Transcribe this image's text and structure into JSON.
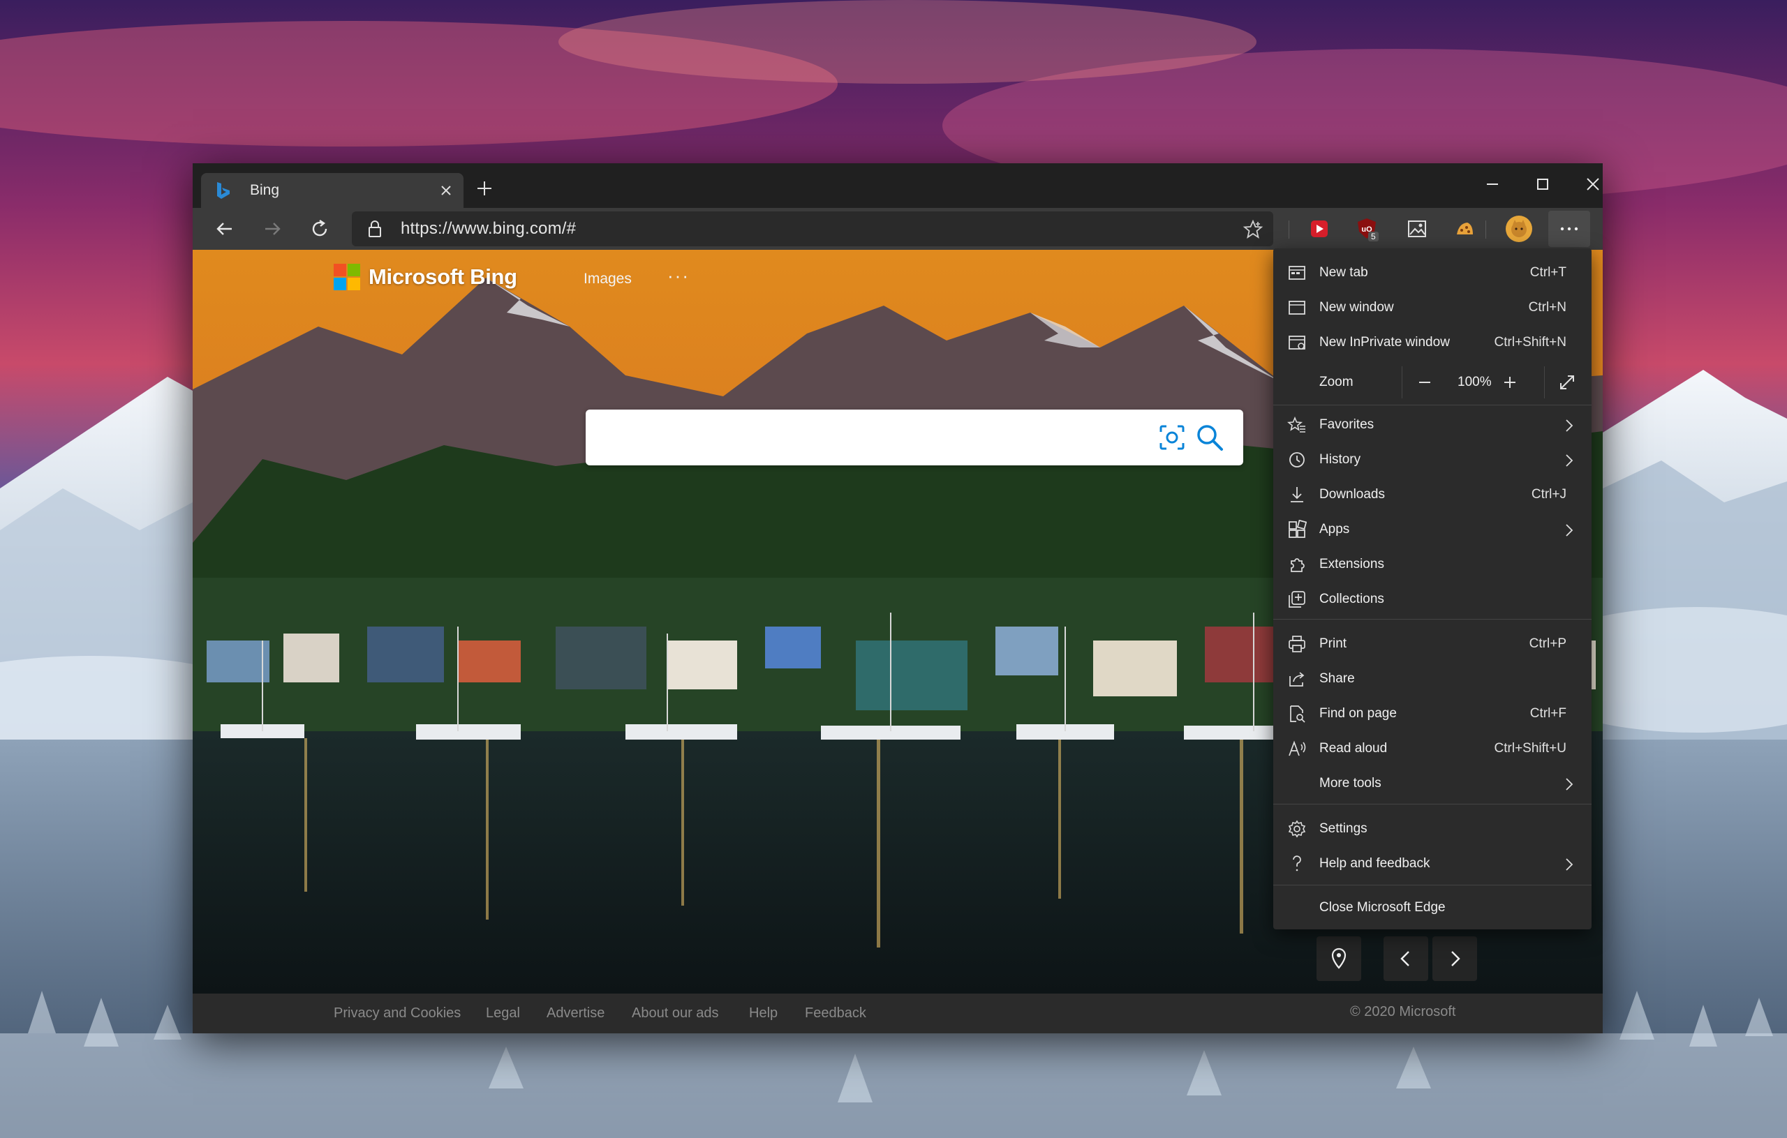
{
  "tab": {
    "title": "Bing"
  },
  "address": {
    "url": "https://www.bing.com/#"
  },
  "extensions": {
    "badge_count": "5"
  },
  "page": {
    "logo_text": "Microsoft Bing",
    "images_link": "Images",
    "more_dots": "···",
    "footer_links": [
      "Privacy and Cookies",
      "Legal",
      "Advertise",
      "About our ads",
      "Help",
      "Feedback"
    ],
    "copyright": "© 2020 Microsoft"
  },
  "menu": {
    "items": [
      {
        "label": "New tab",
        "shortcut": "Ctrl+T",
        "icon": "new-tab-icon"
      },
      {
        "label": "New window",
        "shortcut": "Ctrl+N",
        "icon": "new-window-icon"
      },
      {
        "label": "New InPrivate window",
        "shortcut": "Ctrl+Shift+N",
        "icon": "inprivate-window-icon"
      },
      {
        "label": "Favorites",
        "shortcut": "",
        "icon": "favorites-icon"
      },
      {
        "label": "History",
        "shortcut": "",
        "icon": "history-icon"
      },
      {
        "label": "Downloads",
        "shortcut": "Ctrl+J",
        "icon": "downloads-icon"
      },
      {
        "label": "Apps",
        "shortcut": "",
        "icon": "apps-icon"
      },
      {
        "label": "Extensions",
        "shortcut": "",
        "icon": "extensions-icon"
      },
      {
        "label": "Collections",
        "shortcut": "",
        "icon": "collections-icon"
      },
      {
        "label": "Print",
        "shortcut": "Ctrl+P",
        "icon": "print-icon"
      },
      {
        "label": "Share",
        "shortcut": "",
        "icon": "share-icon"
      },
      {
        "label": "Find on page",
        "shortcut": "Ctrl+F",
        "icon": "find-on-page-icon"
      },
      {
        "label": "Read aloud",
        "shortcut": "Ctrl+Shift+U",
        "icon": "read-aloud-icon"
      },
      {
        "label": "More tools",
        "shortcut": "",
        "icon": ""
      },
      {
        "label": "Settings",
        "shortcut": "",
        "icon": "settings-icon"
      },
      {
        "label": "Help and feedback",
        "shortcut": "",
        "icon": "help-icon"
      },
      {
        "label": "Close Microsoft Edge",
        "shortcut": "",
        "icon": ""
      }
    ],
    "zoom": {
      "label": "Zoom",
      "value": "100%"
    }
  },
  "colors": {
    "window_bg": "#202020",
    "toolbar_bg": "#3b3b3b",
    "menu_bg": "#2b2b2b",
    "ms_red": "#f25022",
    "ms_green": "#7fba00",
    "ms_blue": "#00a4ef",
    "ms_yellow": "#ffb900",
    "accent": "#0a84d8"
  }
}
